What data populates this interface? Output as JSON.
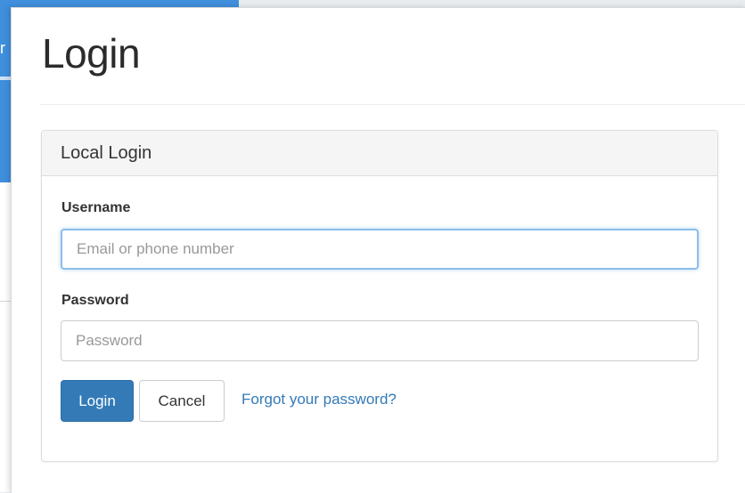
{
  "backdrop": {
    "text_fragment": "r"
  },
  "page": {
    "title": "Login"
  },
  "panel": {
    "heading": "Local Login"
  },
  "form": {
    "username_label": "Username",
    "username_placeholder": "Email or phone number",
    "username_value": "",
    "password_label": "Password",
    "password_placeholder": "Password",
    "password_value": "",
    "login_button": "Login",
    "cancel_button": "Cancel",
    "forgot_link": "Forgot your password?"
  },
  "colors": {
    "primary": "#337ab7",
    "backdrop_accent": "#3f8fdc",
    "focus_border": "#8cbde8"
  }
}
